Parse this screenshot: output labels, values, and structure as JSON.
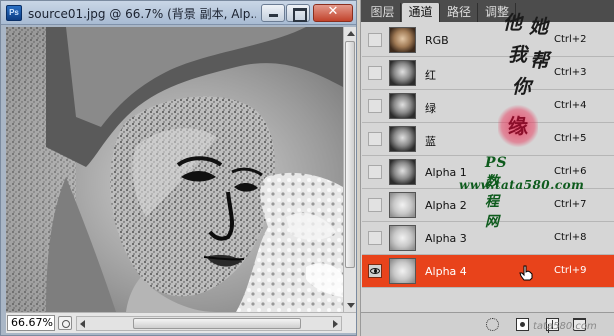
{
  "document": {
    "title": "source01.jpg @ 66.7% (背景 副本, Alp...",
    "app_icon_label": "Ps",
    "close_label": "✕",
    "zoom": "66.67%"
  },
  "panel": {
    "tabs": [
      {
        "label": "图层",
        "active": false
      },
      {
        "label": "通道",
        "active": true
      },
      {
        "label": "路径",
        "active": false
      },
      {
        "label": "调整",
        "active": false
      }
    ],
    "channels": [
      {
        "name": "RGB",
        "shortcut": "Ctrl+2",
        "visible": false,
        "selected": false,
        "thumb": "color"
      },
      {
        "name": "红",
        "shortcut": "Ctrl+3",
        "visible": false,
        "selected": false,
        "thumb": "gray"
      },
      {
        "name": "绿",
        "shortcut": "Ctrl+4",
        "visible": false,
        "selected": false,
        "thumb": "gray"
      },
      {
        "name": "蓝",
        "shortcut": "Ctrl+5",
        "visible": false,
        "selected": false,
        "thumb": "gray"
      },
      {
        "name": "Alpha 1",
        "shortcut": "Ctrl+6",
        "visible": false,
        "selected": false,
        "thumb": "gray"
      },
      {
        "name": "Alpha 2",
        "shortcut": "Ctrl+7",
        "visible": false,
        "selected": false,
        "thumb": "light"
      },
      {
        "name": "Alpha 3",
        "shortcut": "Ctrl+8",
        "visible": false,
        "selected": false,
        "thumb": "light"
      },
      {
        "name": "Alpha 4",
        "shortcut": "Ctrl+9",
        "visible": true,
        "selected": true,
        "thumb": "light"
      }
    ],
    "selected_color": "#e8431b"
  },
  "watermark": {
    "chars": [
      "他",
      "她",
      "我",
      "帮",
      "你"
    ],
    "seal": "缘",
    "line1": "PS数程网",
    "line2": "www.tata580.com",
    "bottom": "tata580.com"
  }
}
